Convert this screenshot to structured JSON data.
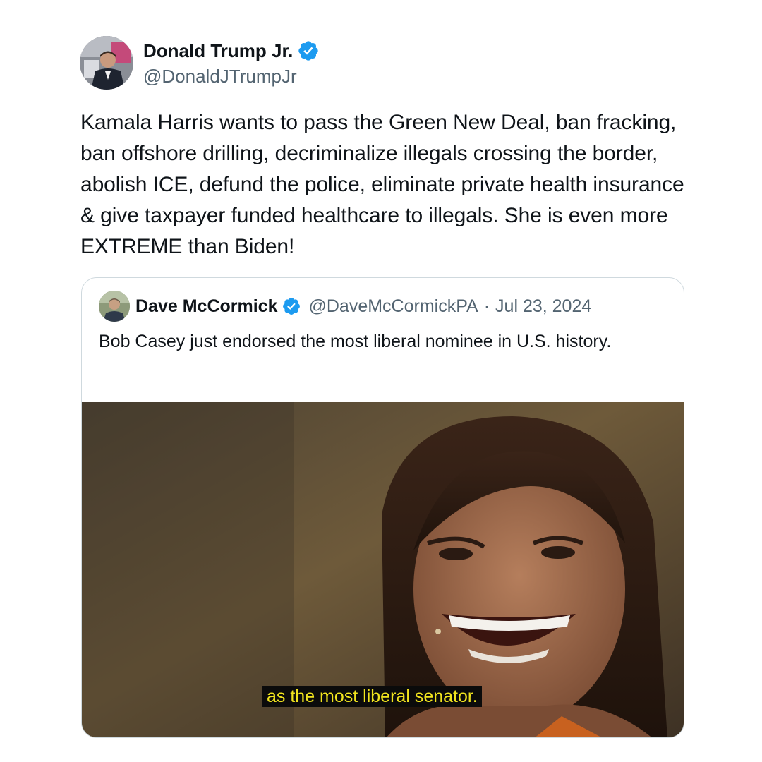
{
  "author": {
    "name": "Donald Trump Jr.",
    "handle": "@DonaldJTrumpJr",
    "avatar_icon": "profile-photo",
    "verified_icon": "verified-badge-icon",
    "verified_color": "#1d9bf0"
  },
  "tweet": {
    "text": "Kamala Harris wants to pass the Green New Deal, ban fracking, ban offshore drilling, decriminalize illegals crossing the border, abolish ICE, defund the police, eliminate private health insurance & give taxpayer funded healthcare to illegals. She is even more EXTREME than Biden!"
  },
  "quote": {
    "name": "Dave McCormick",
    "handle": "@DaveMcCormickPA",
    "separator": "·",
    "date": "Jul 23, 2024",
    "text": "Bob Casey just endorsed the most liberal nominee in U.S. history.",
    "media": {
      "caption": "as the most liberal senator.",
      "caption_color": "#f1e41e"
    }
  }
}
